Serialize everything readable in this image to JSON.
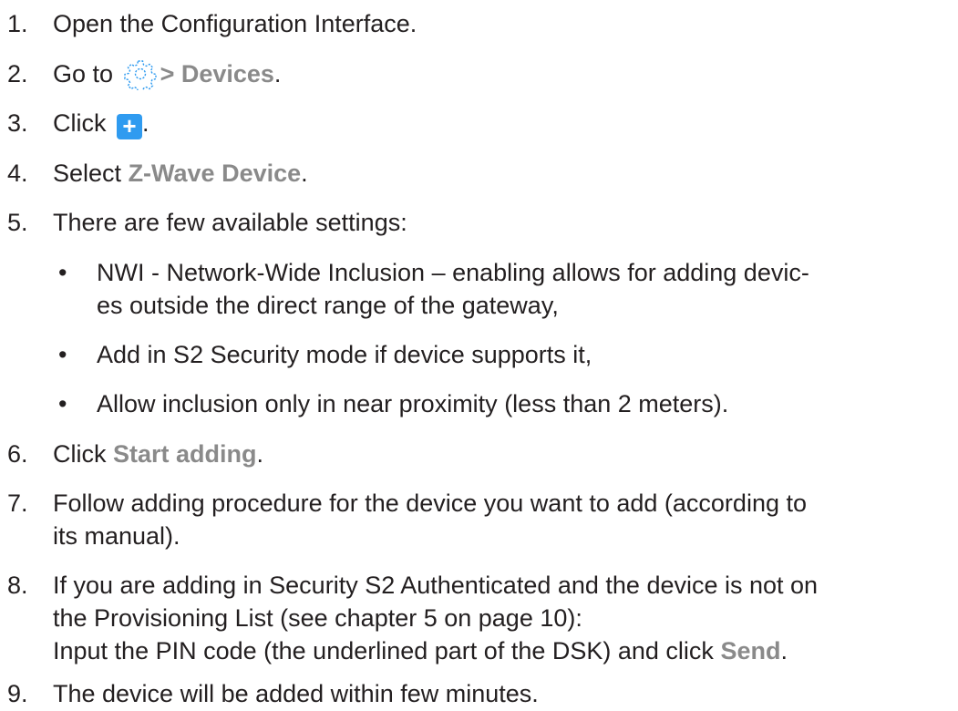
{
  "steps": [
    {
      "num": "1.",
      "text": "Open the Configuration Interface."
    },
    {
      "num": "2.",
      "pre": "Go to",
      "icon": "gear-icon",
      "bold": "> Devices",
      "post": "."
    },
    {
      "num": "3.",
      "pre": "Click",
      "icon": "plus-icon",
      "icon_glyph": "+",
      "post": "."
    },
    {
      "num": "4.",
      "pre": "Select",
      "bold": "Z-Wave Device",
      "post": "."
    },
    {
      "num": "5.",
      "text": "There are few available settings:"
    },
    {
      "num": "6.",
      "pre": "Click",
      "bold": "Start adding",
      "post": "."
    },
    {
      "num": "7.",
      "line1": "Follow adding procedure for the device you want to add (according to",
      "line2": "its manual)."
    },
    {
      "num": "8.",
      "line1": "If you are adding in Security S2 Authenticated and the device is not on",
      "line2": "the Provisioning List (see chapter 5 on page 10):",
      "line3_pre": "Input the PIN code (the underlined part of the DSK) and click",
      "line3_bold": "Send",
      "line3_post": "."
    },
    {
      "num": "9.",
      "text": "The device will be added within few minutes."
    }
  ],
  "bullets": [
    {
      "symbol": "•",
      "line1": "NWI - Network-Wide Inclusion – enabling allows for adding devic-",
      "line2": "es outside the direct range of the gateway,"
    },
    {
      "symbol": "•",
      "line1": "Add in S2 Security mode if device supports it,"
    },
    {
      "symbol": "•",
      "line1": "Allow inclusion only in near proximity (less than 2 meters)."
    }
  ],
  "colors": {
    "text": "#231f20",
    "bold": "#8a8a8a",
    "accent": "#2f9bf0"
  }
}
